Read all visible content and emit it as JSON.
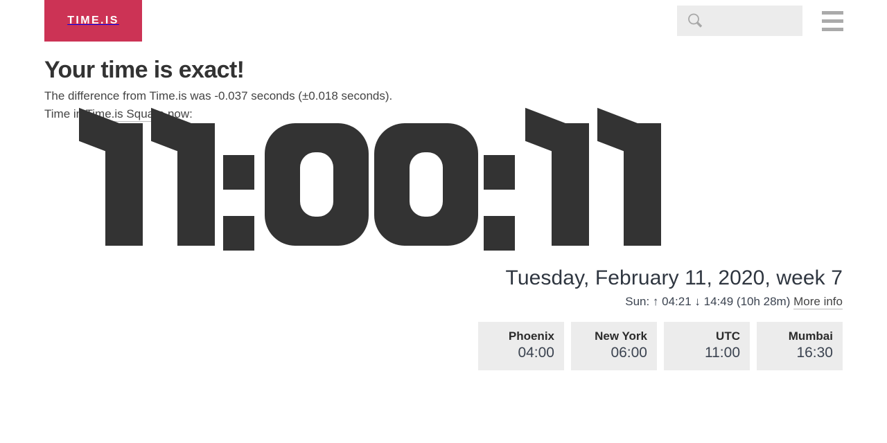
{
  "site": {
    "logo_text": "TIME.IS",
    "logo_color": "#cc3355"
  },
  "header": {
    "search_placeholder": "",
    "search_value": "",
    "search_icon": "search-icon",
    "menu_icon": "hamburger-menu-icon"
  },
  "status": {
    "headline": "Your time is exact!",
    "difference_text": "The difference from Time.is was -0.037 seconds (±0.018 seconds).",
    "location_prefix": "Time in ",
    "location_link": "Time.is Square",
    "location_suffix": " now:"
  },
  "clock": {
    "time": "11:00:11",
    "hours": "11",
    "minutes": "00",
    "seconds": "11",
    "separator": ":",
    "color": "#333333"
  },
  "date": {
    "full": "Tuesday, February 11, 2020, week 7",
    "weekday": "Tuesday",
    "month": "February",
    "day": "11",
    "year": "2020",
    "week": "week 7"
  },
  "sun": {
    "label": "Sun:",
    "sunrise_icon": "↑",
    "sunrise": "04:21",
    "sunset_icon": "↓",
    "sunset": "14:49",
    "daylength": "(10h 28m)",
    "line": "Sun: ↑ 04:21 ↓ 14:49 (10h 28m)",
    "more_info_link": "More info"
  },
  "cities": [
    {
      "name": "Phoenix",
      "time": "04:00"
    },
    {
      "name": "New York",
      "time": "06:00"
    },
    {
      "name": "UTC",
      "time": "11:00"
    },
    {
      "name": "Mumbai",
      "time": "16:30"
    }
  ]
}
